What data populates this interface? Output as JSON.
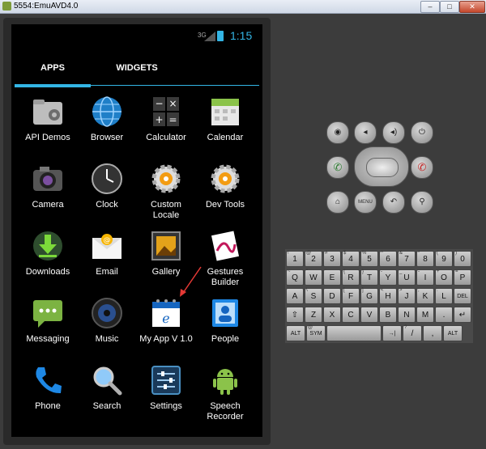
{
  "window": {
    "title": "5554:EmuAVD4.0",
    "buttons": [
      "–",
      "□",
      "✕"
    ]
  },
  "status_bar": {
    "network": "3G",
    "time": "1:15",
    "accent": "#33b5e5"
  },
  "tabs": [
    {
      "label": "APPS",
      "selected": true
    },
    {
      "label": "WIDGETS",
      "selected": false
    }
  ],
  "apps": [
    {
      "label": "API Demos",
      "icon": "folder-gear-icon"
    },
    {
      "label": "Browser",
      "icon": "globe-icon"
    },
    {
      "label": "Calculator",
      "icon": "calculator-icon"
    },
    {
      "label": "Calendar",
      "icon": "calendar-icon"
    },
    {
      "label": "Camera",
      "icon": "camera-icon"
    },
    {
      "label": "Clock",
      "icon": "clock-icon"
    },
    {
      "label": "Custom Locale",
      "icon": "gear-icon"
    },
    {
      "label": "Dev Tools",
      "icon": "gear-icon"
    },
    {
      "label": "Downloads",
      "icon": "download-icon"
    },
    {
      "label": "Email",
      "icon": "envelope-icon"
    },
    {
      "label": "Gallery",
      "icon": "gallery-icon"
    },
    {
      "label": "Gestures Builder",
      "icon": "gestures-icon"
    },
    {
      "label": "Messaging",
      "icon": "chat-bubble-icon"
    },
    {
      "label": "Music",
      "icon": "speaker-icon"
    },
    {
      "label": "My App V 1.0",
      "icon": "myapp-calendar-icon"
    },
    {
      "label": "People",
      "icon": "contacts-icon"
    },
    {
      "label": "Phone",
      "icon": "phone-handset-icon"
    },
    {
      "label": "Search",
      "icon": "magnifier-icon"
    },
    {
      "label": "Settings",
      "icon": "sliders-icon"
    },
    {
      "label": "Speech Recorder",
      "icon": "android-robot-icon"
    }
  ],
  "hardware_buttons": {
    "row1": [
      "camera-icon",
      "volume-down-icon",
      "volume-up-icon",
      "power-icon"
    ],
    "call_icon": "call-icon",
    "end_call_icon": "end-call-icon",
    "row3": [
      "home-icon",
      "MENU",
      "back-icon",
      "search-icon"
    ]
  },
  "keyboard": {
    "row1": [
      [
        "1",
        "!"
      ],
      [
        "2",
        "@"
      ],
      [
        "3",
        "#"
      ],
      [
        "4",
        "$"
      ],
      [
        "5",
        "%"
      ],
      [
        "6",
        "^"
      ],
      [
        "7",
        "&"
      ],
      [
        "8",
        "*"
      ],
      [
        "9",
        "("
      ],
      [
        "0",
        ")"
      ]
    ],
    "row2": [
      [
        "Q",
        "~"
      ],
      [
        "W",
        "\""
      ],
      [
        "E",
        "`"
      ],
      [
        "R",
        "{"
      ],
      [
        "T",
        "}"
      ],
      [
        "Y",
        "-"
      ],
      [
        "U",
        "_"
      ],
      [
        "I",
        "-"
      ],
      [
        "O",
        "+"
      ],
      [
        "P",
        "="
      ]
    ],
    "row3": [
      [
        "A",
        ""
      ],
      [
        "S",
        "\\"
      ],
      [
        "D",
        ""
      ],
      [
        "F",
        "["
      ],
      [
        "G",
        "]"
      ],
      [
        "H",
        "<"
      ],
      [
        "J",
        ">"
      ],
      [
        "K",
        ";"
      ],
      [
        "L",
        ":"
      ],
      [
        "DEL",
        ""
      ]
    ],
    "row4": [
      [
        "⇧",
        ""
      ],
      [
        "Z",
        ""
      ],
      [
        "X",
        ""
      ],
      [
        "C",
        ""
      ],
      [
        "V",
        ""
      ],
      [
        "B",
        ""
      ],
      [
        "N",
        ""
      ],
      [
        "M",
        ""
      ],
      [
        ".",
        ""
      ],
      [
        "↵",
        ""
      ]
    ],
    "row5": [
      [
        "ALT",
        ""
      ],
      [
        "SYM",
        "@"
      ],
      [
        "",
        ""
      ],
      [
        "→|",
        ""
      ],
      [
        "/",
        "?"
      ],
      [
        ",",
        ""
      ],
      [
        "ALT",
        ""
      ]
    ]
  }
}
